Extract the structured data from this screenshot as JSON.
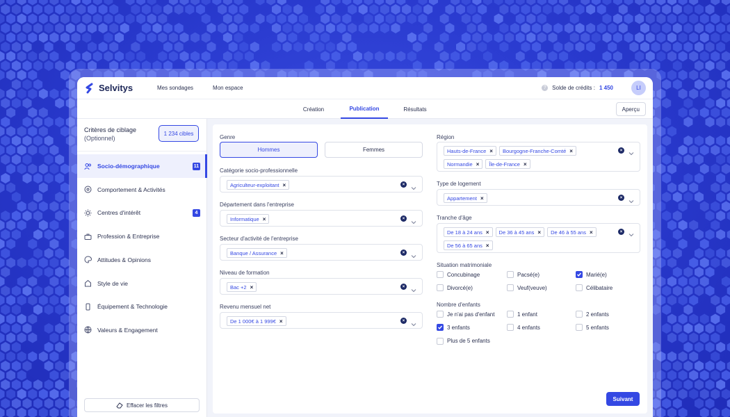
{
  "app": {
    "brand": "Selvitys",
    "nav": [
      "Mes sondages",
      "Mon espace"
    ],
    "credits_label": "Solde de crédits :",
    "credits_value": "1 450",
    "avatar_initials": "LI"
  },
  "tabs": [
    {
      "label": "Création"
    },
    {
      "label": "Publication"
    },
    {
      "label": "Résultats"
    }
  ],
  "preview_label": "Aperçu",
  "sidebar": {
    "title": "Critères de ciblage",
    "subtitle": "(Optionnel)",
    "targets_label": "1 234 cibles",
    "categories": [
      {
        "label": "Socio-démographique",
        "icon": "users-icon",
        "badge": "11"
      },
      {
        "label": "Comportement & Activités",
        "icon": "activity-icon",
        "badge": ""
      },
      {
        "label": "Centres d'intérêt",
        "icon": "sun-icon",
        "badge": "4"
      },
      {
        "label": "Profession & Entreprise",
        "icon": "briefcase-icon",
        "badge": ""
      },
      {
        "label": "Attitudes & Opinions",
        "icon": "palette-icon",
        "badge": ""
      },
      {
        "label": "Style de vie",
        "icon": "home-icon",
        "badge": ""
      },
      {
        "label": "Équipement & Technologie",
        "icon": "phone-icon",
        "badge": ""
      },
      {
        "label": "Valeurs & Engagement",
        "icon": "globe-icon",
        "badge": ""
      }
    ],
    "clear_label": "Effacer les filtres"
  },
  "form": {
    "genre_label": "Genre",
    "genre_options": [
      "Hommes",
      "Femmes"
    ],
    "csp_label": "Catégorie socio-professionnelle",
    "csp_chips": [
      "Agriculteur-exploitant"
    ],
    "dept_label": "Département dans l'entreprise",
    "dept_chips": [
      "Informatique"
    ],
    "sector_label": "Secteur d'activité de l'entreprise",
    "sector_chips": [
      "Banque / Assurance"
    ],
    "education_label": "Niveau de formation",
    "education_chips": [
      "Bac +2"
    ],
    "income_label": "Revenu mensuel net",
    "income_chips": [
      "De 1 000€ à 1 999€"
    ],
    "region_label": "Région",
    "region_chips": [
      "Hauts-de-France",
      "Bourgogne-Franche-Comté",
      "Normandie",
      "Île-de-France"
    ],
    "housing_label": "Type de logement",
    "housing_chips": [
      "Appartement"
    ],
    "age_label": "Tranche d'âge",
    "age_chips": [
      "De 18 à 24 ans",
      "De 36 à 45 ans",
      "De 46 à 55 ans",
      "De 56 à 65 ans"
    ],
    "marital_label": "Situation matrimoniale",
    "marital_options": [
      {
        "label": "Concubinage",
        "checked": false
      },
      {
        "label": "Pacsé(e)",
        "checked": false
      },
      {
        "label": "Marié(e)",
        "checked": true
      },
      {
        "label": "Divorcé(e)",
        "checked": false
      },
      {
        "label": "Veuf(veuve)",
        "checked": false
      },
      {
        "label": "Célibataire",
        "checked": false
      }
    ],
    "children_label": "Nombre d'enfants",
    "children_options": [
      {
        "label": "Je n'ai pas d'enfant",
        "checked": false
      },
      {
        "label": "1 enfant",
        "checked": false
      },
      {
        "label": "2 enfants",
        "checked": false
      },
      {
        "label": "3 enfants",
        "checked": true
      },
      {
        "label": "4 enfants",
        "checked": false
      },
      {
        "label": "5 enfants",
        "checked": false
      },
      {
        "label": "Plus de 5 enfants",
        "checked": false
      }
    ],
    "next_label": "Suivant"
  },
  "colors": {
    "accent": "#3448e3",
    "background": "#2536c9"
  }
}
